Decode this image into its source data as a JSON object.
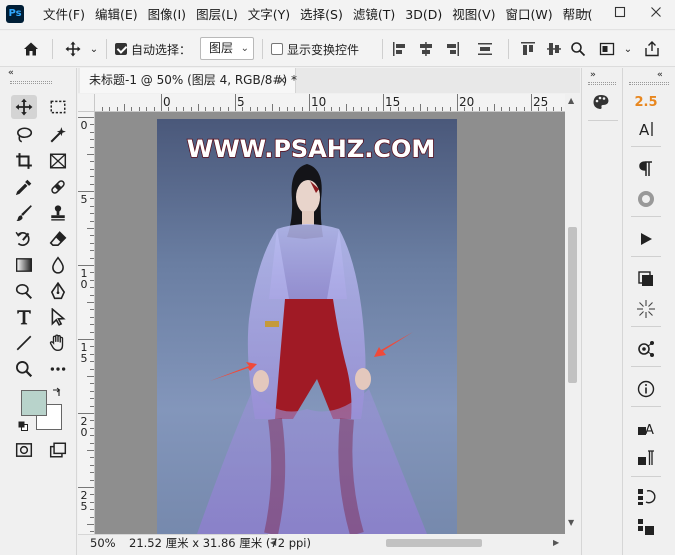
{
  "app": {
    "logo": "Ps"
  },
  "menu": [
    "文件(F)",
    "编辑(E)",
    "图像(I)",
    "图层(L)",
    "文字(Y)",
    "选择(S)",
    "滤镜(T)",
    "3D(D)",
    "视图(V)",
    "窗口(W)",
    "帮助("
  ],
  "options": {
    "auto_select_label": "自动选择：",
    "auto_select_checked": true,
    "layer_dropdown": "图层",
    "show_transform_label": "显示变换控件",
    "show_transform_checked": false
  },
  "document": {
    "tab_title": "未标题-1 @ 50% (图层 4, RGB/8#) *",
    "watermark": "WWW.PSAHZ.COM"
  },
  "ruler": {
    "h_labels": [
      "0",
      "5",
      "10",
      "15",
      "20",
      "25"
    ],
    "v_labels": [
      "0",
      "5",
      "10",
      "15",
      "20",
      "25"
    ]
  },
  "status": {
    "zoom": "50%",
    "size": "21.52 厘米 x 31.86 厘米 (72 ppi)"
  },
  "right_panel": {
    "tool_size": "2.5"
  },
  "colors": {
    "foreground": "#b8d3cb",
    "background": "#ffffff",
    "accent": "#e8871f"
  }
}
